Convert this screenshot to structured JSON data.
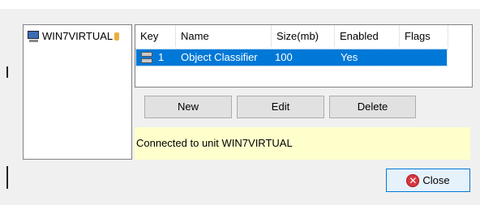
{
  "tree": {
    "node_label": "WIN7VIRTUAL"
  },
  "list": {
    "columns": [
      "Key",
      "Name",
      "Size(mb)",
      "Enabled",
      "Flags"
    ],
    "rows": [
      {
        "key": "1",
        "name": "Object Classifier",
        "size": "100",
        "enabled": "Yes",
        "flags": ""
      }
    ],
    "selection_color": "#0078d7"
  },
  "buttons": {
    "new": "New",
    "edit": "Edit",
    "delete": "Delete",
    "close": "Close"
  },
  "status": {
    "text": "Connected to unit WIN7VIRTUAL",
    "bg_color": "#ffffcc"
  },
  "icons": {
    "tree_node": "computer-icon",
    "row": "classifier-icon",
    "close": "close-icon"
  }
}
